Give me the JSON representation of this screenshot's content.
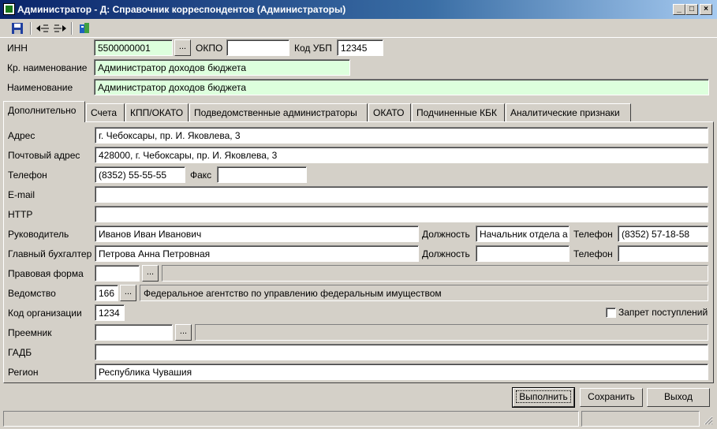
{
  "window": {
    "title": "Администратор - Д: Справочник корреспондентов (Администраторы)",
    "controls": [
      "_",
      "□",
      "×"
    ]
  },
  "toolbar": {
    "icons": [
      "save-icon",
      "collapse-icon",
      "expand-icon",
      "report-icon"
    ]
  },
  "header": {
    "inn_label": "ИНН",
    "inn_value": "5500000001",
    "okpo_label": "ОКПО",
    "okpo_value": "",
    "ubp_label": "Код УБП",
    "ubp_value": "12345",
    "short_name_label": "Кр. наименование",
    "short_name_value": "Администратор доходов бюджета",
    "name_label": "Наименование",
    "name_value": "Администратор доходов бюджета",
    "browse_label": "..."
  },
  "tabs": [
    {
      "label": "Дополнительно",
      "active": true
    },
    {
      "label": "Счета"
    },
    {
      "label": "КПП/ОКАТО"
    },
    {
      "label": "Подведомственные администраторы"
    },
    {
      "label": "ОКАТО"
    },
    {
      "label": "Подчиненные КБК"
    },
    {
      "label": "Аналитические признаки"
    }
  ],
  "details": {
    "address_label": "Адрес",
    "address_value": "г. Чебоксары, пр. И. Яковлева, 3",
    "postal_label": "Почтовый адрес",
    "postal_value": "428000, г. Чебоксары, пр. И. Яковлева, 3",
    "phone_label": "Телефон",
    "phone_value": "(8352) 55-55-55",
    "fax_label": "Факс",
    "fax_value": "",
    "email_label": "E-mail",
    "email_value": "",
    "http_label": "HTTP",
    "http_value": "",
    "head_label": "Руководитель",
    "head_value": "Иванов Иван Иванович",
    "head_position_label": "Должность",
    "head_position_value": "Начальник отдела а",
    "head_phone_label": "Телефон",
    "head_phone_value": "(8352) 57-18-58",
    "accountant_label": "Главный бухгалтер",
    "accountant_value": "Петрова Анна Петровная",
    "accountant_position_label": "Должность",
    "accountant_position_value": "",
    "accountant_phone_label": "Телефон",
    "accountant_phone_value": "",
    "legal_form_label": "Правовая форма",
    "legal_form_value": "",
    "legal_form_desc": "",
    "agency_label": "Ведомство",
    "agency_code": "166",
    "agency_desc": "Федеральное агентство по управлению федеральным имуществом",
    "org_code_label": "Код организации",
    "org_code_value": "1234",
    "ban_label": "Запрет поступлений",
    "successor_label": "Преемник",
    "successor_value": "",
    "successor_desc": "",
    "gadb_label": "ГАДБ",
    "gadb_value": "",
    "region_label": "Регион",
    "region_value": "Республика Чувашия"
  },
  "buttons": {
    "execute": "Выполнить",
    "save": "Сохранить",
    "exit": "Выход"
  }
}
